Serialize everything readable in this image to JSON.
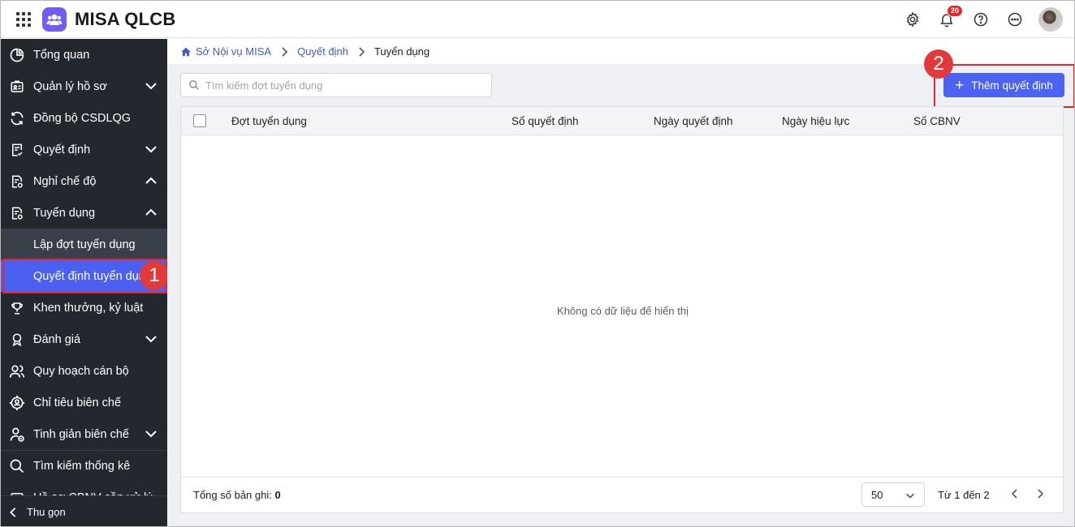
{
  "header": {
    "app_title": "MISA QLCB",
    "notification_count": "20",
    "icons": [
      "apps-grid-icon",
      "settings-icon",
      "bell-icon",
      "help-icon",
      "more-icon",
      "avatar"
    ]
  },
  "sidebar": {
    "items": [
      {
        "label": "Tổng quan",
        "icon": "pie-chart-icon",
        "chevron": ""
      },
      {
        "label": "Quản lý hồ sơ",
        "icon": "profile-card-icon",
        "chevron": "down"
      },
      {
        "label": "Đồng bộ CSDLQG",
        "icon": "sync-icon",
        "chevron": ""
      },
      {
        "label": "Quyết định",
        "icon": "decision-doc-icon",
        "chevron": "down"
      },
      {
        "label": "Nghỉ chế độ",
        "icon": "leave-doc-icon",
        "chevron": "up"
      },
      {
        "label": "Tuyển dụng",
        "icon": "recruit-doc-icon",
        "chevron": "up"
      }
    ],
    "sub_items": [
      {
        "label": "Lập đợt tuyển dụng",
        "active": false
      },
      {
        "label": "Quyết định tuyển dụng",
        "active": true
      }
    ],
    "items_after": [
      {
        "label": "Khen thưởng, kỷ luật",
        "icon": "trophy-icon",
        "chevron": ""
      },
      {
        "label": "Đánh giá",
        "icon": "award-icon",
        "chevron": "down"
      },
      {
        "label": "Quy hoạch cán bộ",
        "icon": "users-icon",
        "chevron": ""
      },
      {
        "label": "Chỉ tiêu biên chế",
        "icon": "target-icon",
        "chevron": ""
      },
      {
        "label": "Tinh giản biên chế",
        "icon": "user-minus-icon",
        "chevron": "down"
      },
      {
        "label": "Tìm kiếm thống kê",
        "icon": "search-icon",
        "chevron": ""
      },
      {
        "label": "Hồ sơ CBNV cần xử lý",
        "icon": "folder-icon",
        "chevron": ""
      }
    ],
    "collapse_label": "Thu gọn"
  },
  "callouts": {
    "one": "1",
    "two": "2"
  },
  "breadcrumb": {
    "items": [
      "Sở Nội vụ MISA",
      "Quyết định"
    ],
    "current": "Tuyển dụng"
  },
  "toolbar": {
    "search_placeholder": "Tìm kiếm đợt tuyển dụng",
    "search_value": "",
    "add_button": "Thêm quyết định"
  },
  "table": {
    "columns": [
      "Đợt tuyển dụng",
      "Số quyết định",
      "Ngày quyết định",
      "Ngày hiệu lực",
      "Số CBNV"
    ],
    "rows": [],
    "empty_text": "Không có dữ liệu để hiển thị"
  },
  "footer": {
    "total_label": "Tổng số bản ghi:",
    "total_value": "0",
    "page_size": "50",
    "range": "Từ 1 đến 2"
  },
  "colors": {
    "sidebar_bg": "#23282f",
    "accent": "#4b63f0",
    "highlight": "#e8262a"
  }
}
